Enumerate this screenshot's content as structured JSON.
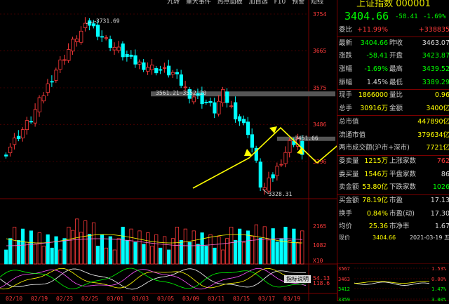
{
  "toolbar": {
    "items": [
      "九转",
      "重大事件",
      "热点面板",
      "加自选",
      "F10",
      "预警",
      "短线"
    ]
  },
  "chart": {
    "price_axis": [
      "3754",
      "3665",
      "3575",
      "3486",
      "3396"
    ],
    "high_label": "3731.69",
    "low_label": "3328.31",
    "band_label": "3561.21~3552.20",
    "last_label": "3451.66",
    "vol_axis": [
      "2165",
      "1082",
      "X10"
    ],
    "ind_axis": [
      "118.6",
      "54.13"
    ],
    "ind_button": "指标说明",
    "dates": [
      "02/10",
      "02/19",
      "02/23",
      "02/25",
      "03/01",
      "03/03",
      "03/05",
      "03/09",
      "03/11",
      "03/15",
      "03/17",
      "03/19"
    ]
  },
  "quote": {
    "title": "上证指数 000001",
    "price": "3404.66",
    "change": "-58.41",
    "pct": "-1.69%",
    "rows": [
      {
        "l1": "委比",
        "v1": "+11.99%",
        "c1": "red",
        "l2": "",
        "v2": "+338835",
        "c2": "red"
      },
      {
        "l1": "最新",
        "v1": "3404.66",
        "c1": "green",
        "l2": "昨收",
        "v2": "3463.07",
        "c2": "white"
      },
      {
        "l1": "涨跌",
        "v1": "-58.41",
        "c1": "green",
        "l2": "开盘",
        "v2": "3423.87",
        "c2": "green"
      },
      {
        "l1": "涨幅",
        "v1": "-1.69%",
        "c1": "green",
        "l2": "最高",
        "v2": "3439.52",
        "c2": "green"
      },
      {
        "l1": "振幅",
        "v1": "1.45%",
        "c1": "white",
        "l2": "最低",
        "v2": "3389.29",
        "c2": "green"
      },
      {
        "l1": "现手",
        "v1": "1866000",
        "c1": "yellow",
        "l2": "量比",
        "v2": "0.96",
        "c2": "yellow"
      },
      {
        "l1": "总手",
        "v1": "30916万",
        "c1": "yellow",
        "l2": "金额",
        "v2": "3400亿",
        "c2": "yellow"
      },
      {
        "l1": "总市值",
        "v1": "",
        "c1": "white",
        "l2": "",
        "v2": "447890亿",
        "c2": "yellow"
      },
      {
        "l1": "流通市值",
        "v1": "",
        "c1": "white",
        "l2": "",
        "v2": "379634亿",
        "c2": "yellow"
      },
      {
        "l1": "两市成交额(沪市+深市)",
        "v1": "",
        "c1": "white",
        "l2": "",
        "v2": "7721亿",
        "c2": "yellow"
      },
      {
        "l1": "委卖量",
        "v1": "1215万",
        "c1": "yellow",
        "l2": "上涨家数",
        "v2": "762",
        "c2": "red"
      },
      {
        "l1": "委买量",
        "v1": "1546万",
        "c1": "yellow",
        "l2": "平盘家数",
        "v2": "86",
        "c2": "white"
      },
      {
        "l1": "卖金额",
        "v1": "53.80亿",
        "c1": "yellow",
        "l2": "下跌家数",
        "v2": "1026",
        "c2": "green"
      },
      {
        "l1": "买金额",
        "v1": "78.19亿",
        "c1": "yellow",
        "l2": "市盈",
        "v2": "17.13",
        "c2": "white"
      },
      {
        "l1": "换手",
        "v1": "0.84%",
        "c1": "yellow",
        "l2": "市盈(动)",
        "v2": "17.30",
        "c2": "white"
      },
      {
        "l1": "均价",
        "v1": "25.36",
        "c1": "yellow",
        "l2": "市净率",
        "v2": "1.67",
        "c2": "white"
      }
    ],
    "partial_row": {
      "l1": "现价",
      "v1": "3404.66",
      "v2": "2021-03-19 五"
    },
    "mini": {
      "left_axis": [
        "3567",
        "3463",
        "3412",
        "3359"
      ],
      "right_axis": [
        "1.53%",
        "0.00%",
        "1.47%",
        "3.00%"
      ]
    }
  },
  "colors": {
    "up": "#ff3a3a",
    "down": "#00ffff",
    "bg": "#000000",
    "grid": "#7a0000",
    "annot": "#ffff00"
  }
}
